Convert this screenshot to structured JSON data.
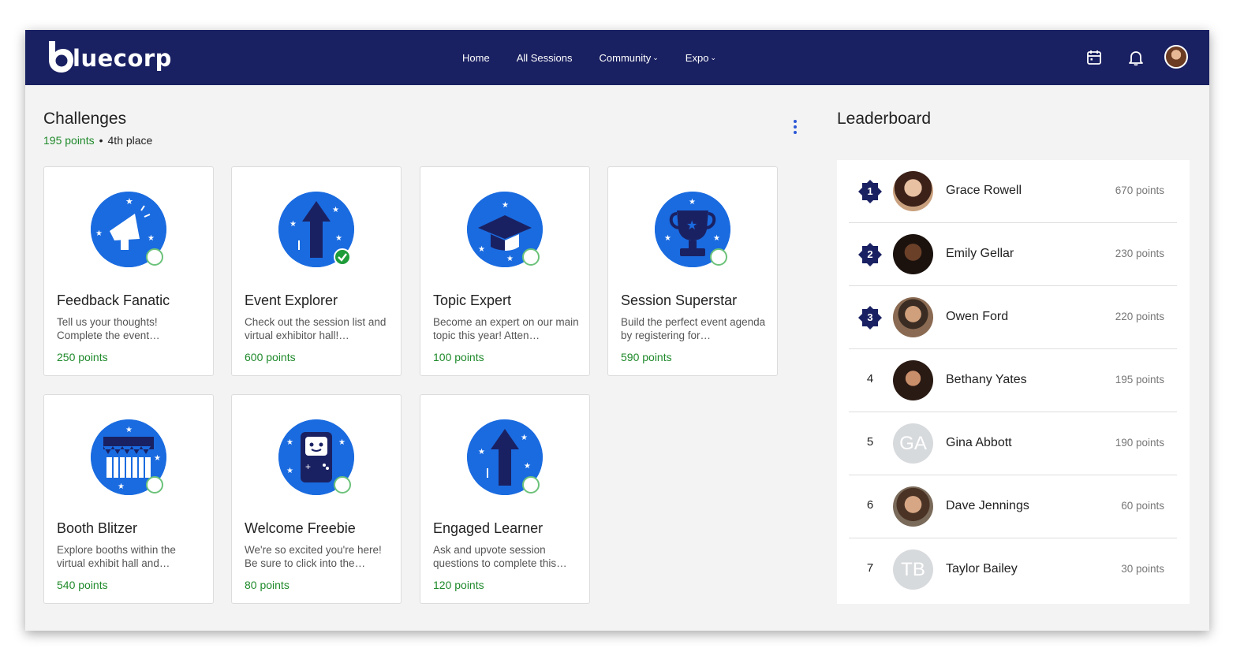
{
  "brand": {
    "logo_text": "luecorp"
  },
  "nav": [
    {
      "label": "Home",
      "has_dropdown": false
    },
    {
      "label": "All Sessions",
      "has_dropdown": false
    },
    {
      "label": "Community",
      "has_dropdown": true
    },
    {
      "label": "Expo",
      "has_dropdown": true
    }
  ],
  "header_icons": [
    "calendar-icon",
    "bell-icon",
    "user-avatar"
  ],
  "challenges": {
    "title": "Challenges",
    "points": "195 points",
    "separator": "•",
    "place": "4th place",
    "items": [
      {
        "title": "Feedback Fanatic",
        "desc": "Tell us your thoughts! Complete the event…",
        "points": "250 points",
        "icon": "megaphone-icon",
        "completed": false
      },
      {
        "title": "Event Explorer",
        "desc": "Check out the session list and virtual exhibitor hall!…",
        "points": "600 points",
        "icon": "arrow-up-icon",
        "completed": true
      },
      {
        "title": "Topic Expert",
        "desc": "Become an expert on our main topic this year! Atten…",
        "points": "100 points",
        "icon": "graduation-cap-icon",
        "completed": false
      },
      {
        "title": "Session Superstar",
        "desc": "Build the perfect event agenda by registering for…",
        "points": "590 points",
        "icon": "trophy-icon",
        "completed": false
      },
      {
        "title": "Booth Blitzer",
        "desc": "Explore booths within the virtual exhibit hall and…",
        "points": "540 points",
        "icon": "booth-icon",
        "completed": false
      },
      {
        "title": "Welcome Freebie",
        "desc": "We're so excited you're here! Be sure to click into the…",
        "points": "80 points",
        "icon": "game-console-icon",
        "completed": false
      },
      {
        "title": "Engaged Learner",
        "desc": "Ask and upvote session questions to complete this…",
        "points": "120 points",
        "icon": "arrow-up-icon",
        "completed": false
      }
    ]
  },
  "leaderboard": {
    "title": "Leaderboard",
    "rows": [
      {
        "rank": "1",
        "name": "Grace Rowell",
        "points": "670 points",
        "initials": "",
        "badge": true
      },
      {
        "rank": "2",
        "name": "Emily Gellar",
        "points": "230 points",
        "initials": "",
        "badge": true
      },
      {
        "rank": "3",
        "name": "Owen Ford",
        "points": "220 points",
        "initials": "",
        "badge": true
      },
      {
        "rank": "4",
        "name": "Bethany Yates",
        "points": "195 points",
        "initials": "",
        "badge": false
      },
      {
        "rank": "5",
        "name": "Gina Abbott",
        "points": "190 points",
        "initials": "GA",
        "badge": false
      },
      {
        "rank": "6",
        "name": "Dave Jennings",
        "points": "60 points",
        "initials": "",
        "badge": false
      },
      {
        "rank": "7",
        "name": "Taylor Bailey",
        "points": "30 points",
        "initials": "TB",
        "badge": false
      }
    ]
  },
  "colors": {
    "header_bg": "#1a2162",
    "badge_blue": "#1a6be0",
    "points_green": "#1f8a2b",
    "rank_badge": "#1a2162"
  }
}
